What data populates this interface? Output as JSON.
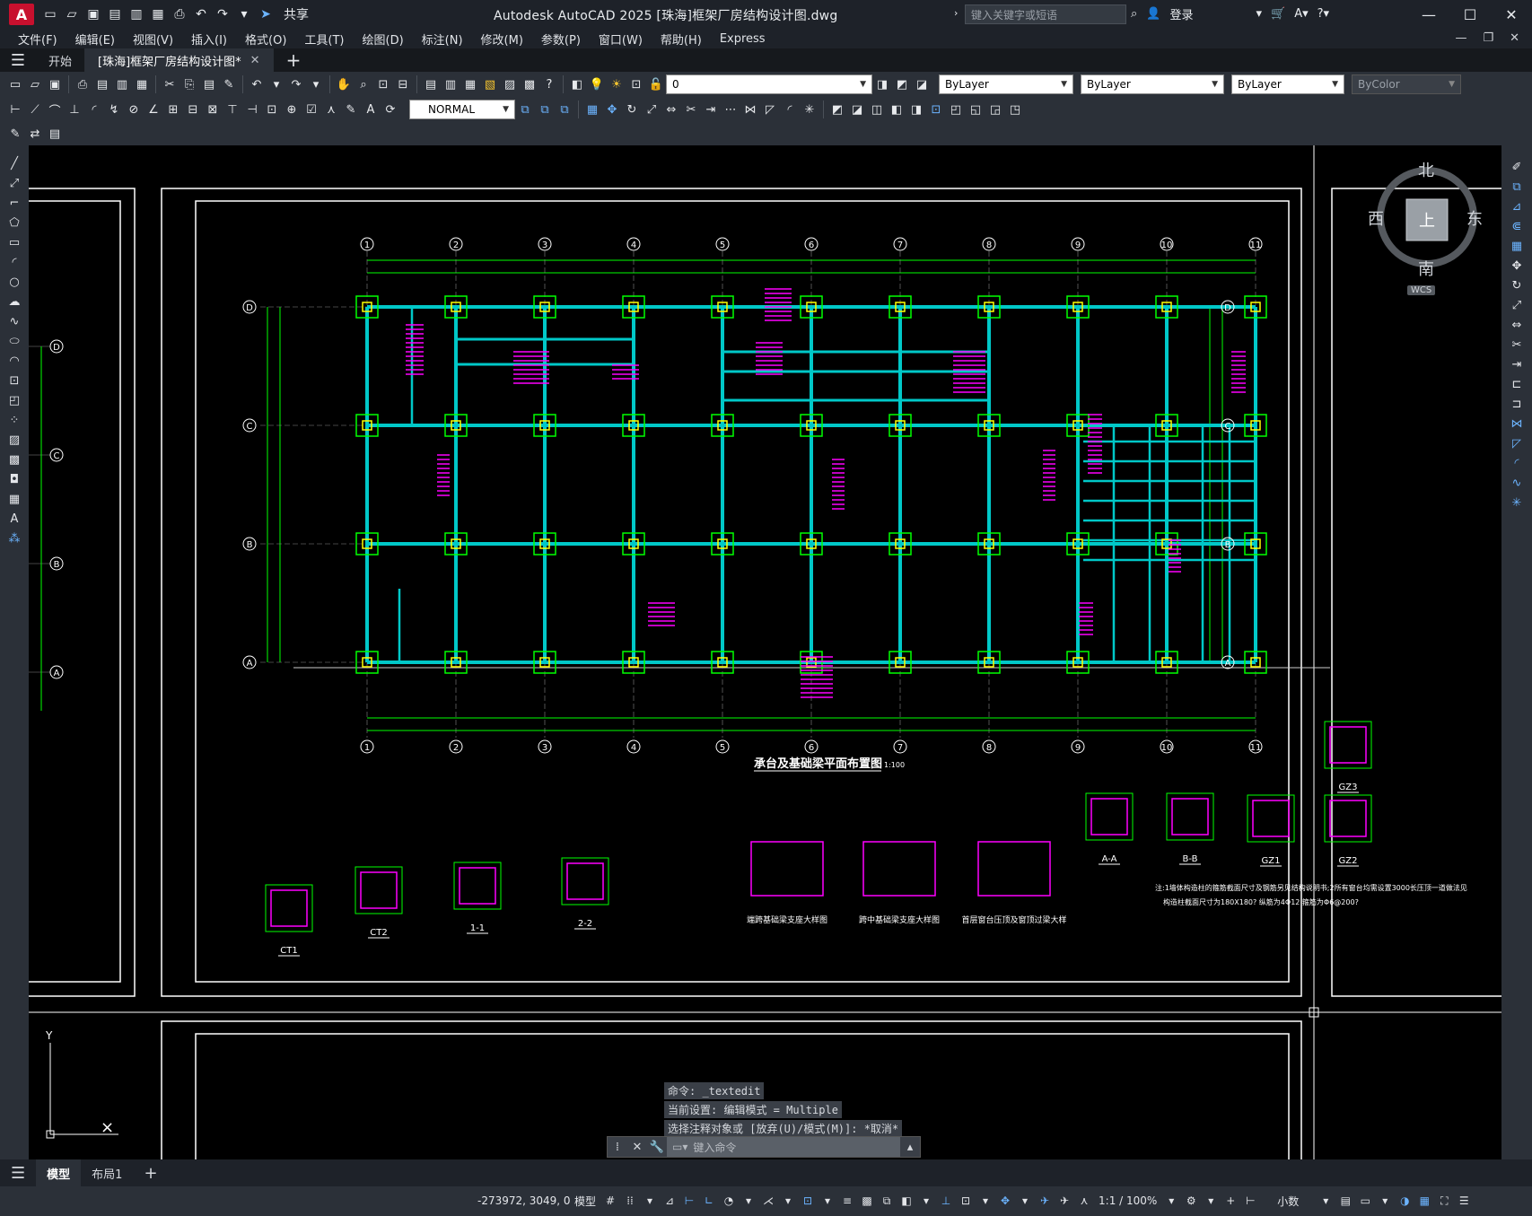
{
  "titlebar": {
    "app_letter": "A",
    "share": "共享",
    "title": "Autodesk AutoCAD 2025    [珠海]框架厂房结构设计图.dwg",
    "search_placeholder": "键入关键字或短语",
    "login": "登录"
  },
  "menu": {
    "items": [
      "文件(F)",
      "编辑(E)",
      "视图(V)",
      "插入(I)",
      "格式(O)",
      "工具(T)",
      "绘图(D)",
      "标注(N)",
      "修改(M)",
      "参数(P)",
      "窗口(W)",
      "帮助(H)",
      "Express"
    ]
  },
  "tabs": {
    "start": "开始",
    "drawing": "[珠海]框架厂房结构设计图*"
  },
  "toolbar": {
    "layer_value": "0",
    "color_value": "ByLayer",
    "linetype_value": "ByLayer",
    "lineweight_value": "ByLayer",
    "plotstyle_value": "ByColor",
    "dimstyle_value": "NORMAL"
  },
  "viewcube": {
    "north": "北",
    "south": "南",
    "east": "东",
    "west": "西",
    "top": "上",
    "wcs": "WCS"
  },
  "drawing": {
    "plan_title": "承台及基础梁平面布置图",
    "plan_scale": "1:100",
    "grid_cols": [
      "1",
      "2",
      "3",
      "4",
      "5",
      "6",
      "7",
      "8",
      "9",
      "10",
      "11"
    ],
    "grid_rows": [
      "D",
      "C",
      "B",
      "A"
    ],
    "details": [
      "CT1",
      "CT2",
      "1-1",
      "2-2",
      "A-A",
      "B-B",
      "GZ1",
      "GZ2",
      "GZ3"
    ],
    "detail_titles": [
      "端跨基础梁支座大样图",
      "跨中基础梁支座大样图",
      "首层窗台压顶及窗顶过梁大样"
    ],
    "note_line1": "注:1墙体构造柱的箍筋截面尺寸及钢筋另见结构说明书;2所有窗台均需设置3000长压顶一道做法见",
    "note_line2": "构造柱截面尺寸为180X180? 纵筋为4Φ12 箍筋为Φ6@200?"
  },
  "command": {
    "line1": "命令: _textedit",
    "line2": "当前设置: 编辑模式 = Multiple",
    "line3": "选择注释对象或 [放弃(U)/模式(M)]: *取消*",
    "input_placeholder": "键入命令"
  },
  "layout_tabs": {
    "model": "模型",
    "layout1": "布局1"
  },
  "status": {
    "coords": "-273972, 3049, 0",
    "model": "模型",
    "scale": "1:1 / 100%",
    "units": "小数"
  },
  "colors": {
    "accent": "#6cb4ff",
    "canvas": "#000000",
    "beam": "#00c8c8",
    "annotation": "#ff00ff",
    "dimension": "#00ff00",
    "column": "#ffff00"
  }
}
